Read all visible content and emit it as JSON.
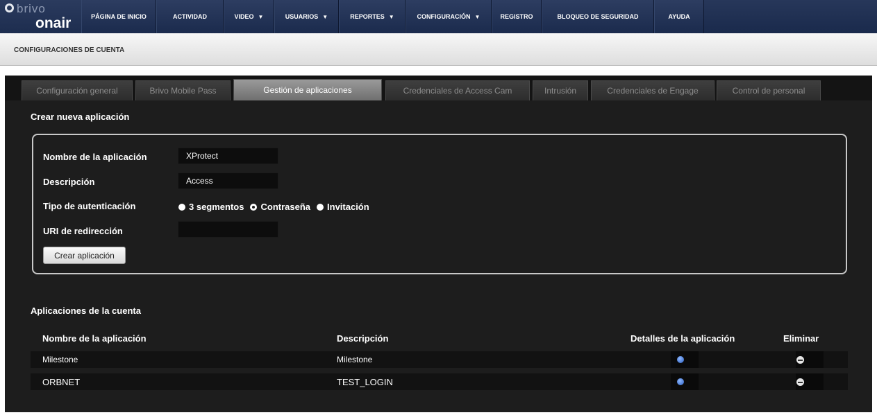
{
  "logo": {
    "brand_top": "brivo",
    "brand_bottom": "onair"
  },
  "nav": [
    {
      "label": "PÁGINA DE INICIO",
      "caret": false
    },
    {
      "label": "ACTIVIDAD",
      "caret": false
    },
    {
      "label": "VIDEO",
      "caret": true
    },
    {
      "label": "USUARIOS",
      "caret": true
    },
    {
      "label": "REPORTES",
      "caret": true
    },
    {
      "label": "CONFIGURACIÓN",
      "caret": true
    },
    {
      "label": "REGISTRO",
      "caret": false
    },
    {
      "label": "BLOQUEO DE SEGURIDAD",
      "caret": false
    },
    {
      "label": "AYUDA",
      "caret": false
    }
  ],
  "page_title": "CONFIGURACIONES DE CUENTA",
  "tabs": [
    {
      "label": "Configuración general",
      "active": false
    },
    {
      "label": "Brivo Mobile Pass",
      "active": false
    },
    {
      "label": "Gestión de aplicaciones",
      "active": true
    },
    {
      "label": "Credenciales de Access Cam",
      "active": false
    },
    {
      "label": "Intrusión",
      "active": false
    },
    {
      "label": "Credenciales de Engage",
      "active": false
    },
    {
      "label": "Control de personal",
      "active": false
    }
  ],
  "create_section": {
    "title": "Crear nueva aplicación",
    "name_label": "Nombre de la aplicación",
    "name_value": "XProtect",
    "description_label": "Descripción",
    "description_value": "Access",
    "auth_label": "Tipo de autenticación",
    "auth_options": [
      {
        "label": "3 segmentos",
        "selected": false
      },
      {
        "label": "Contraseña",
        "selected": true
      },
      {
        "label": "Invitación",
        "selected": false
      }
    ],
    "redirect_label": "URI de redirección",
    "redirect_value": "",
    "create_button": "Crear aplicación"
  },
  "apps_section": {
    "title": "Aplicaciones de la cuenta",
    "columns": [
      "Nombre de la aplicación",
      "Descripción",
      "Detalles de la aplicación",
      "Eliminar"
    ],
    "rows": [
      {
        "name": "Milestone",
        "description": "Milestone"
      },
      {
        "name": "ORBNET",
        "description": "TEST_LOGIN"
      }
    ]
  },
  "icons": {
    "details": "info-icon",
    "delete": "remove-icon"
  },
  "colors": {
    "nav_bg": "#1f2f52",
    "panel_bg": "#1d1d1d",
    "active_tab": "#8a8a8a"
  }
}
